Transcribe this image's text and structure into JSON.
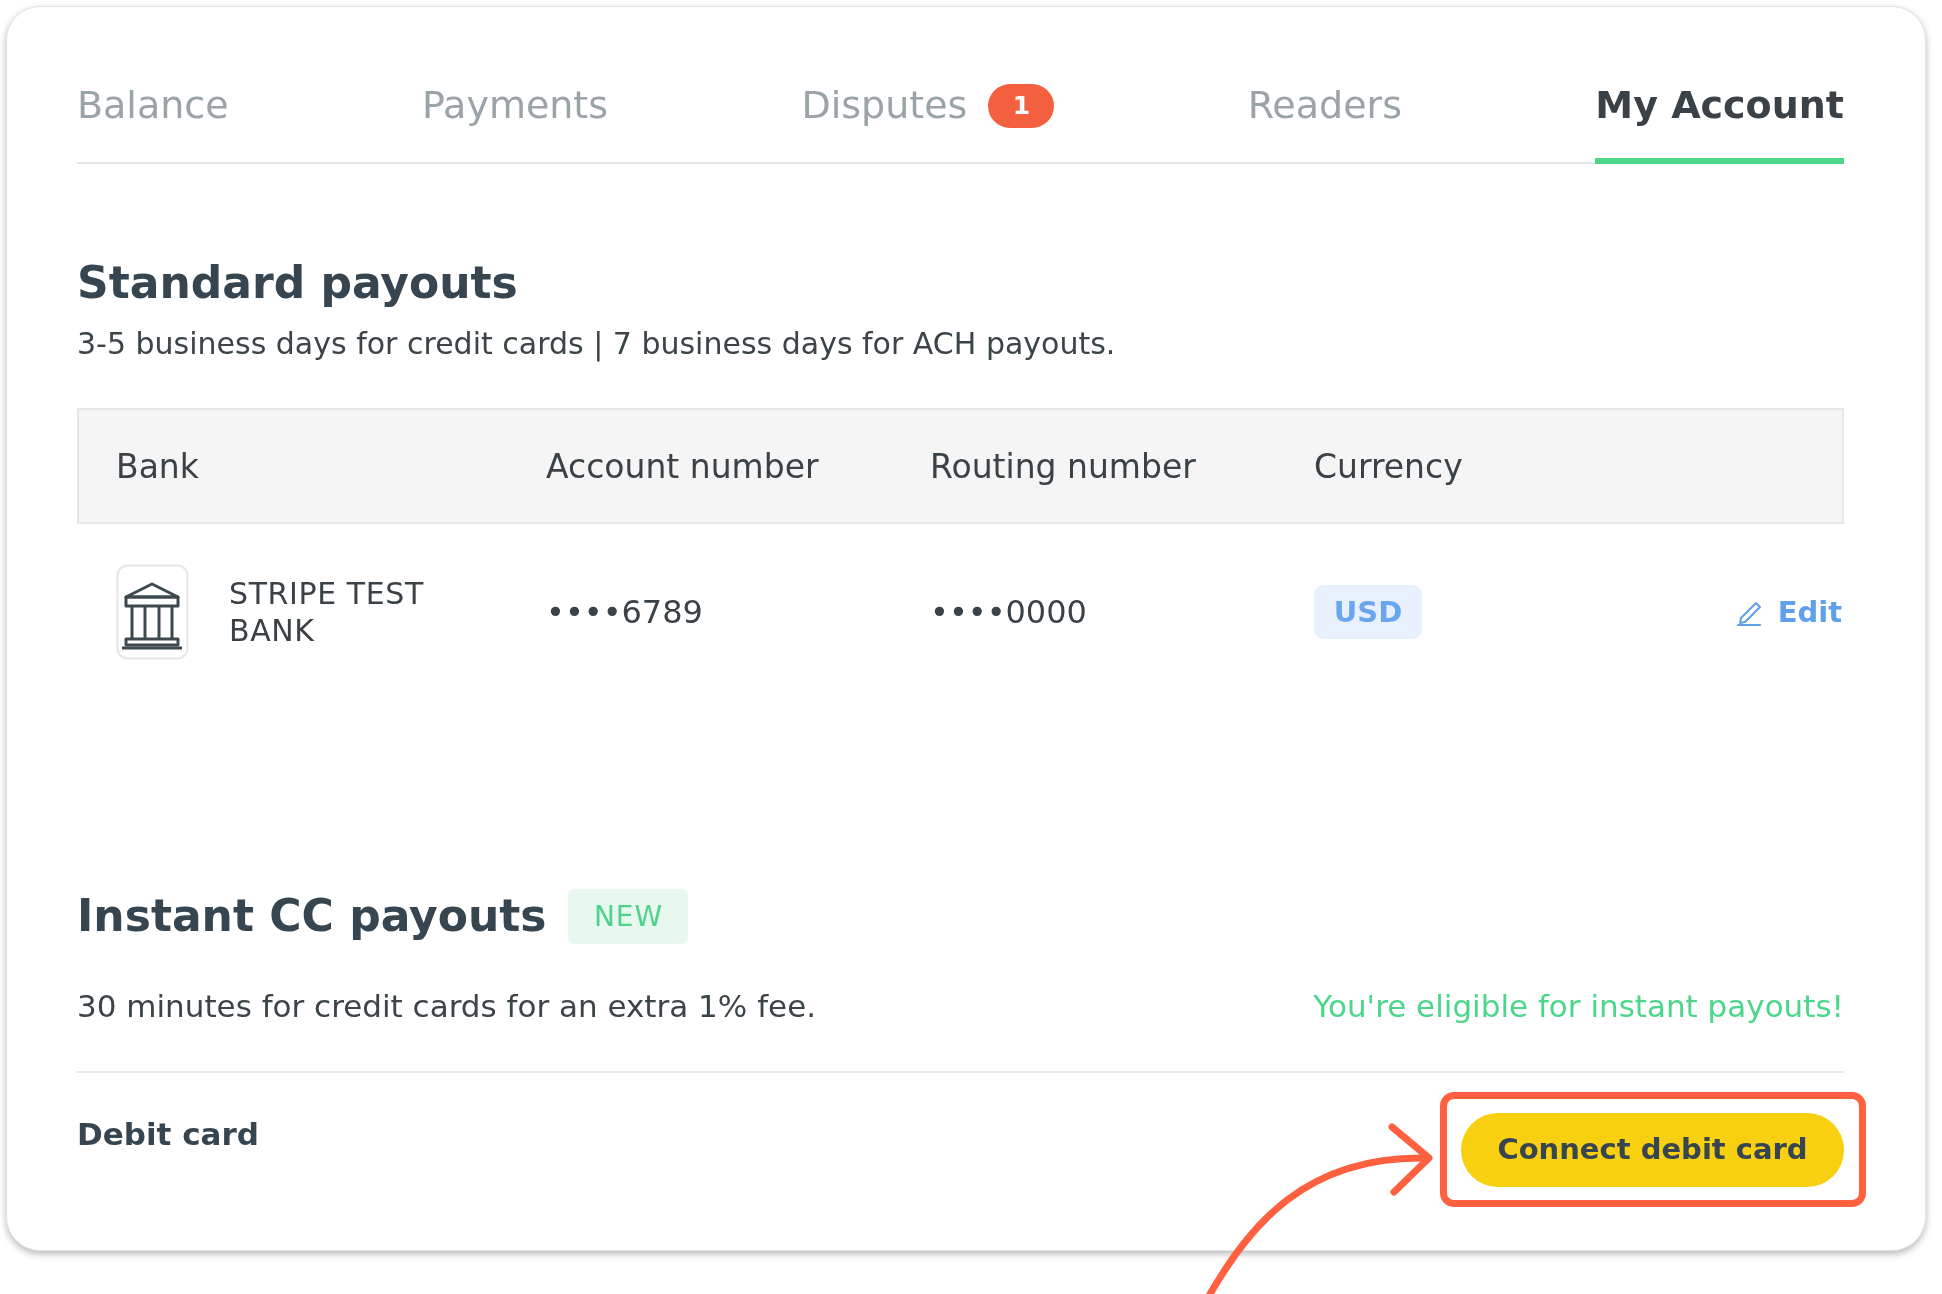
{
  "tabs": [
    {
      "label": "Balance",
      "selected": false
    },
    {
      "label": "Payments",
      "selected": false
    },
    {
      "label": "Disputes",
      "selected": false,
      "badge": "1"
    },
    {
      "label": "Readers",
      "selected": false
    },
    {
      "label": "My Account",
      "selected": true
    }
  ],
  "standard_payouts": {
    "title": "Standard payouts",
    "subtitle": "3-5 business days for credit cards | 7 business days for ACH payouts.",
    "table": {
      "columns": [
        "Bank",
        "Account number",
        "Routing number",
        "Currency"
      ],
      "rows": [
        {
          "bank": "STRIPE TEST BANK",
          "account_number": "••••6789",
          "routing_number": "••••0000",
          "currency": "USD",
          "action": "Edit"
        }
      ]
    }
  },
  "instant_payouts": {
    "title": "Instant CC payouts",
    "badge": "NEW",
    "description": "30 minutes for credit cards for an extra 1% fee.",
    "eligibility": "You're eligible for instant payouts!",
    "debit_card": {
      "label": "Debit card",
      "button": "Connect debit card"
    }
  }
}
